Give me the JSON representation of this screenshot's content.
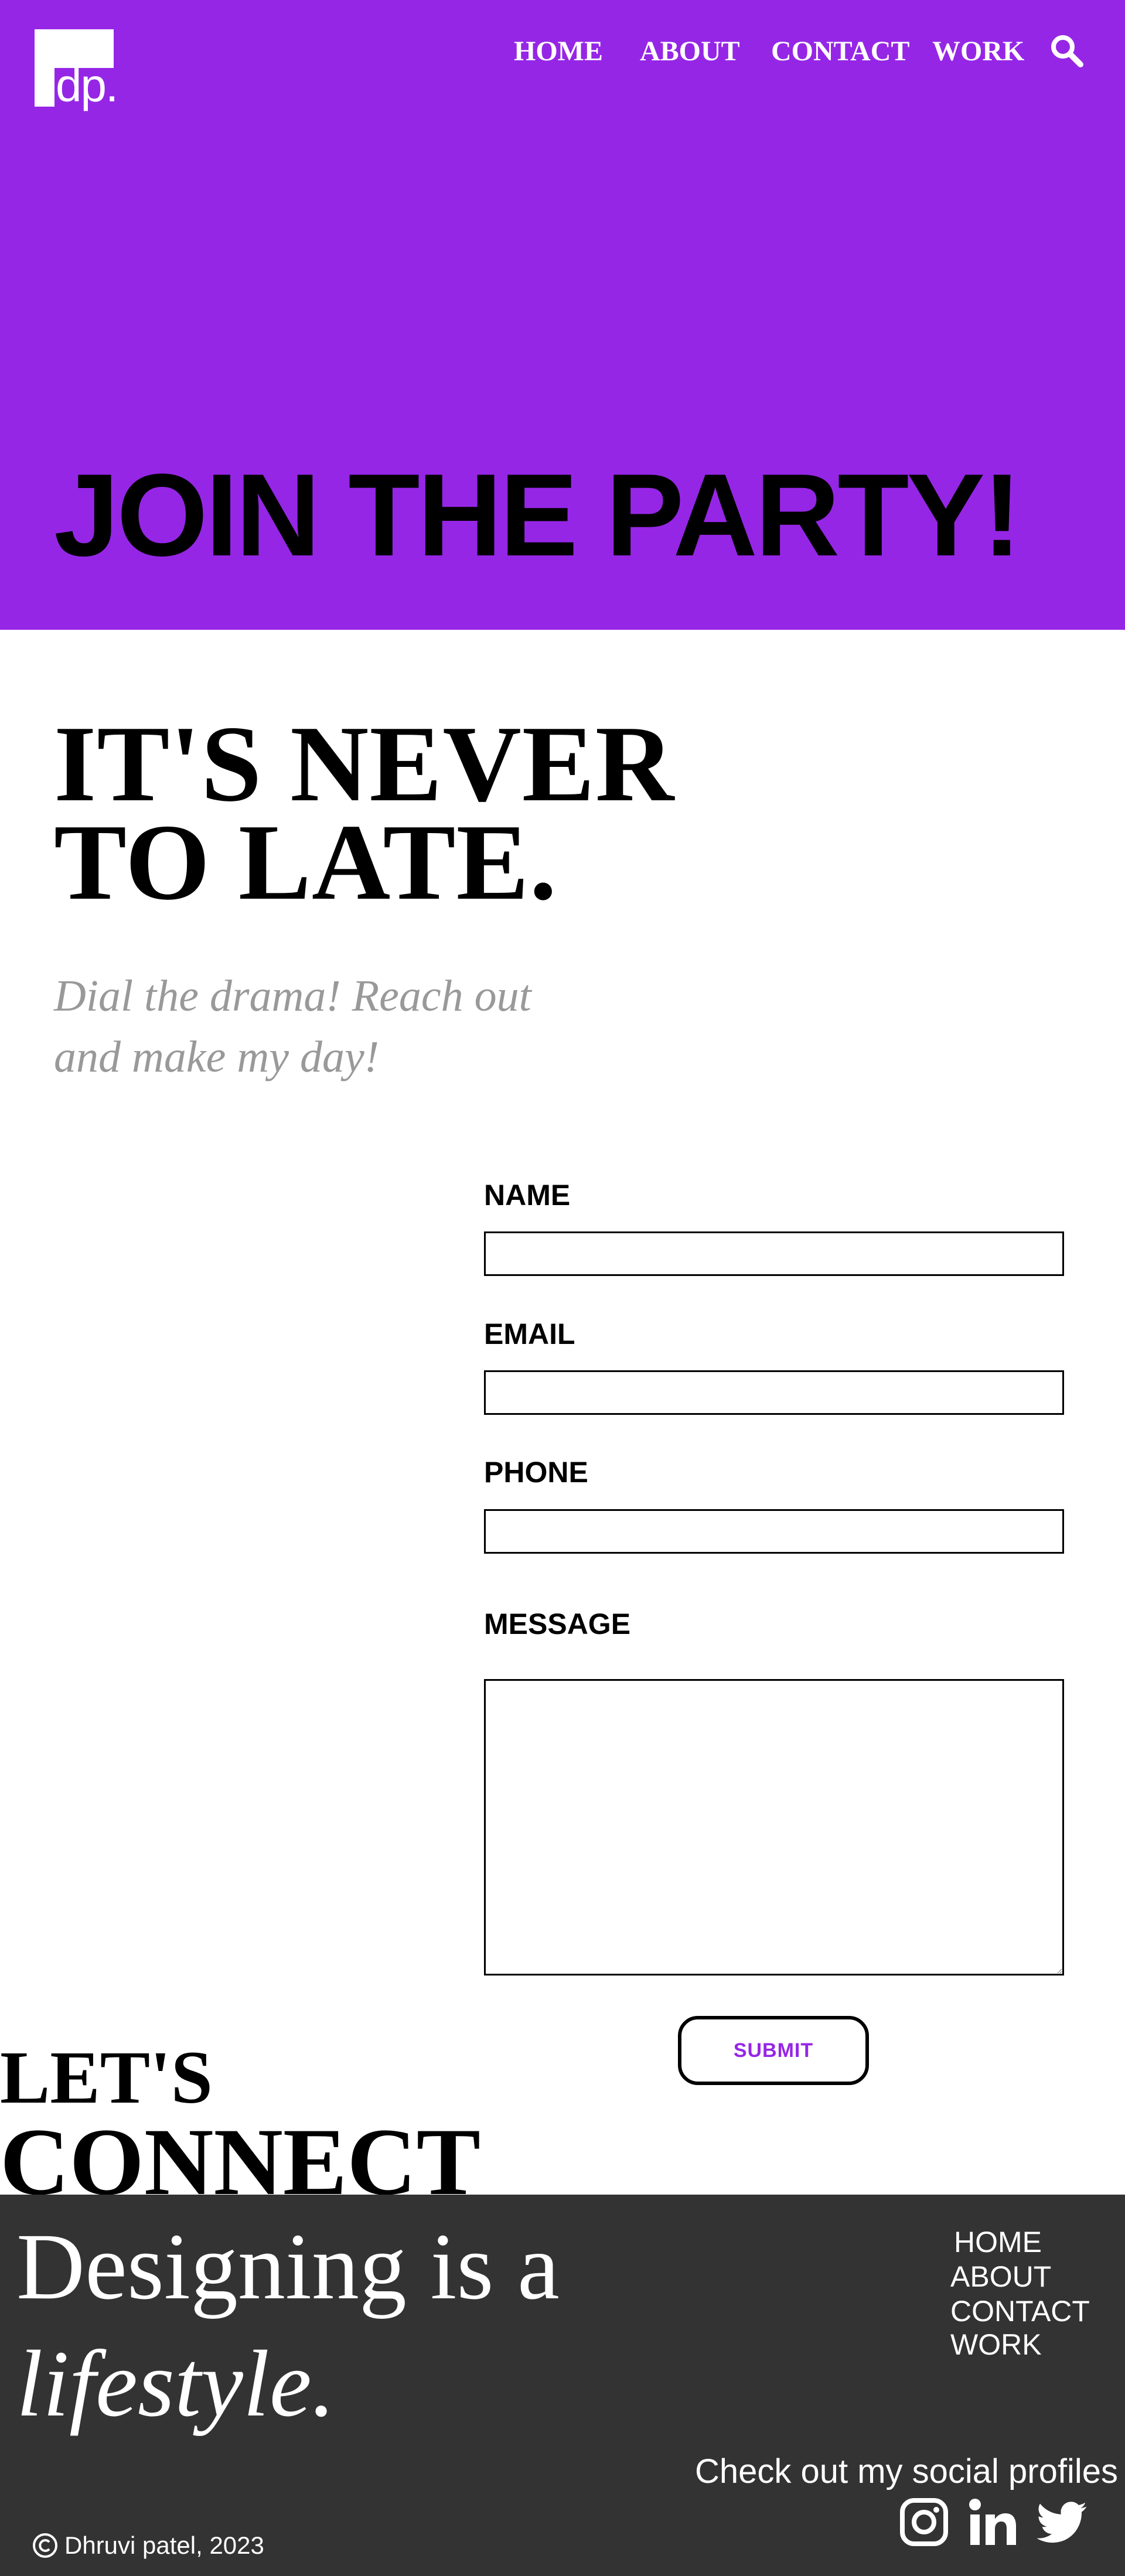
{
  "brand": {
    "logo_text": "dp."
  },
  "nav": {
    "items": [
      {
        "label": "HOME"
      },
      {
        "label": "ABOUT"
      },
      {
        "label": "CONTACT"
      },
      {
        "label": "WORK"
      }
    ],
    "search_icon": "search-icon"
  },
  "hero": {
    "title": "JOIN THE PARTY!"
  },
  "intro": {
    "heading_line1": "IT'S NEVER",
    "heading_line2": "TO LATE.",
    "subheading_line1": "Dial the drama! Reach out",
    "subheading_line2": "and make my day!"
  },
  "form": {
    "name_label": "NAME",
    "email_label": "EMAIL",
    "phone_label": "PHONE",
    "message_label": "MESSAGE",
    "name_value": "",
    "email_value": "",
    "phone_value": "",
    "message_value": "",
    "submit_label": "SUBMIT"
  },
  "connect": {
    "line1": "LET'S",
    "line2": "CONNECT"
  },
  "footer": {
    "tagline_line1": "Designing is a",
    "tagline_line2": "lifestyle.",
    "nav_items": [
      {
        "label": "HOME"
      },
      {
        "label": "ABOUT"
      },
      {
        "label": "CONTACT"
      },
      {
        "label": "WORK"
      }
    ],
    "social_heading": "Check out my social profiles",
    "social_icons": [
      "instagram-icon",
      "linkedin-icon",
      "twitter-icon"
    ],
    "copyright": "Dhruvi patel, 2023"
  },
  "colors": {
    "accent": "#9626e6",
    "footer_bg": "#333333",
    "subheading": "#999999"
  }
}
